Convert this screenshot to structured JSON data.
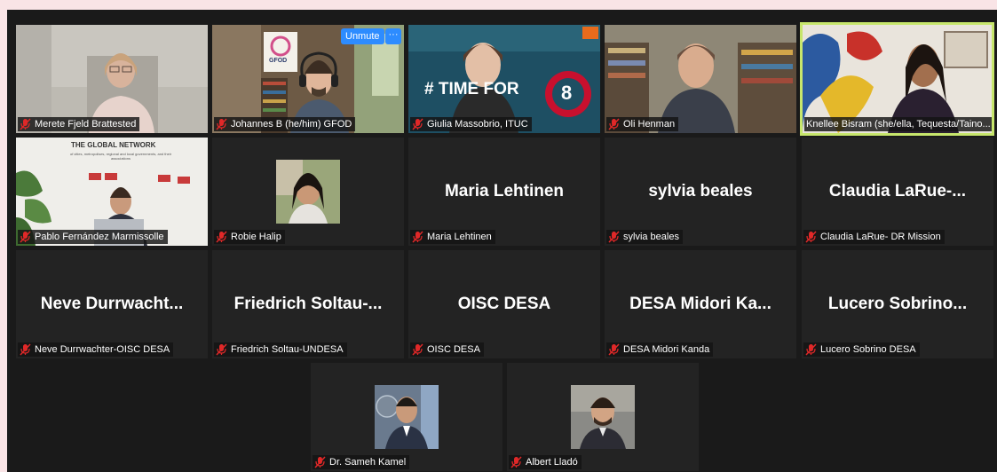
{
  "controls": {
    "unmute_label": "Unmute",
    "more_label": "···"
  },
  "colors": {
    "active_speaker": "#c7e66c",
    "button_blue": "#2d8cff",
    "muted_red": "#e02828"
  },
  "participants": [
    {
      "name": "Merete Fjeld Brattested",
      "big_name": ""
    },
    {
      "name": "Johannes B (he/him) GFOD",
      "big_name": ""
    },
    {
      "name": "Giulia Massobrio, ITUC",
      "big_name": ""
    },
    {
      "name": "Oli Henman",
      "big_name": ""
    },
    {
      "name": "Knellee Bisram (she/ella, Tequesta/Taino...",
      "big_name": ""
    },
    {
      "name": "Pablo Fernández Marmissolle",
      "big_name": ""
    },
    {
      "name": "Robie Halip",
      "big_name": ""
    },
    {
      "name": "Maria Lehtinen",
      "big_name": "Maria Lehtinen"
    },
    {
      "name": "sylvia beales",
      "big_name": "sylvia beales"
    },
    {
      "name": "Claudia LaRue- DR Mission",
      "big_name": "Claudia LaRue-..."
    },
    {
      "name": "Neve Durrwachter-OISC DESA",
      "big_name": "Neve Durrwacht..."
    },
    {
      "name": "Friedrich Soltau-UNDESA",
      "big_name": "Friedrich Soltau-..."
    },
    {
      "name": "OISC DESA",
      "big_name": "OISC DESA"
    },
    {
      "name": "DESA Midori Kanda",
      "big_name": "DESA Midori Ka..."
    },
    {
      "name": "Lucero Sobrino DESA",
      "big_name": "Lucero Sobrino..."
    },
    {
      "name": "Dr. Sameh Kamel",
      "big_name": ""
    },
    {
      "name": "Albert Lladó",
      "big_name": ""
    }
  ],
  "scene_text": {
    "gfod_sign": "GFOD",
    "hashtag": "# TIME FOR",
    "sdg_number": "8",
    "network_title": "THE GLOBAL NETWORK",
    "network_sub": "of cities, metropolises, regional and local governments, and their associations"
  }
}
